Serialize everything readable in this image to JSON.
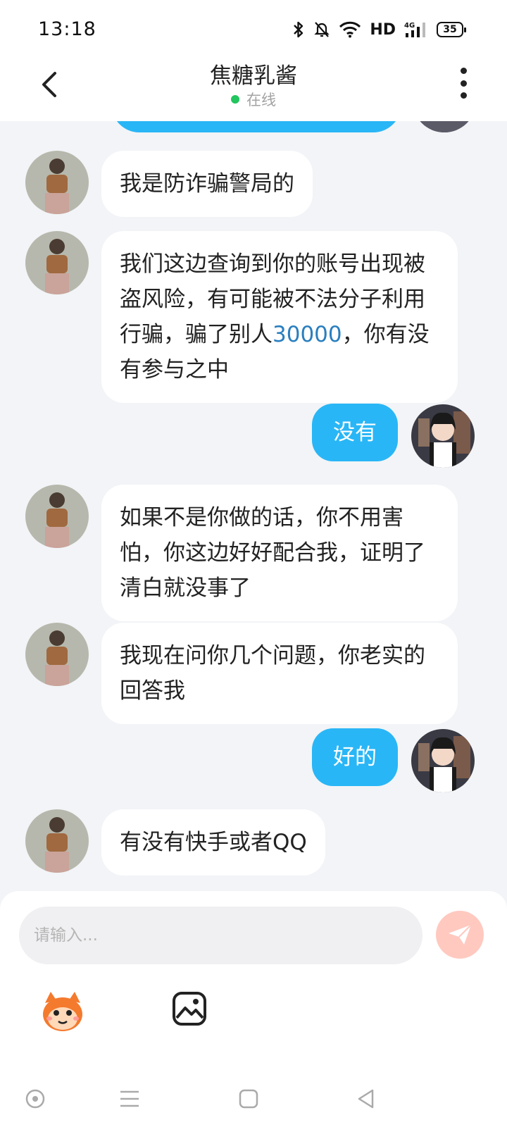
{
  "status_bar": {
    "time": "13:18",
    "network": "HD",
    "signal_label": "4G",
    "battery": "35",
    "icons": [
      "bluetooth-icon",
      "mute-bell-icon",
      "wifi-icon",
      "signal-icon",
      "battery-icon"
    ]
  },
  "header": {
    "title": "焦糖乳酱",
    "status": "在线",
    "status_color": "#22c55e"
  },
  "messages": [
    {
      "side": "in",
      "text": "我是防诈骗警局的"
    },
    {
      "side": "in",
      "parts": [
        "我们这边查询到你的账号出现被盗风险，有可能被不法分子利用行骗，骗了别人",
        "30000",
        "，你有没有参与之中"
      ]
    },
    {
      "side": "out",
      "text": "没有"
    },
    {
      "side": "in",
      "text": "如果不是你做的话，你不用害怕，你这边好好配合我，证明了清白就没事了"
    },
    {
      "side": "in",
      "text": "我现在问你几个问题，你老实的回答我"
    },
    {
      "side": "out",
      "text": "好的"
    },
    {
      "side": "in",
      "text": "有没有快手或者QQ"
    }
  ],
  "composer": {
    "placeholder": "请输入...",
    "send_icon": "send-icon",
    "emoji_icon": "emoji-sticker-icon",
    "image_icon": "image-icon"
  },
  "colors": {
    "outgoing_bubble": "#29b6f6",
    "incoming_bubble": "#ffffff",
    "background": "#f2f4f7",
    "send_button": "#ffc9c0"
  },
  "navbar": {
    "icons": [
      "home-circle-icon",
      "menu-icon",
      "square-icon",
      "back-triangle-icon"
    ]
  }
}
